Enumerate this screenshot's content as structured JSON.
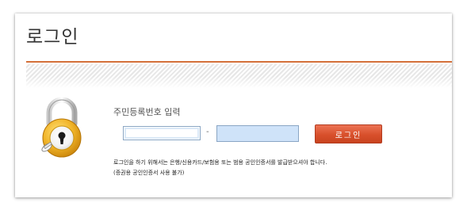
{
  "page": {
    "title": "로그인"
  },
  "form": {
    "field_label": "주민등록번호 입력",
    "first_input_value": "",
    "separator": "-",
    "second_input_value": "",
    "submit_label": "로그인"
  },
  "notice": {
    "line1": "로그인을 하기 위해서는 은행/신용카드/보험용 또는 범용 공인인증서를 발급받으셔야 합니다.",
    "line2": "(증권용 공인인증서 사용 불가)"
  },
  "icons": {
    "lock": "padlock-keyhole-icon"
  },
  "colors": {
    "accent": "#d4703a",
    "button": "#d8502c",
    "input_highlight": "#cfe3f9",
    "lock_gold": "#e8a41d"
  }
}
